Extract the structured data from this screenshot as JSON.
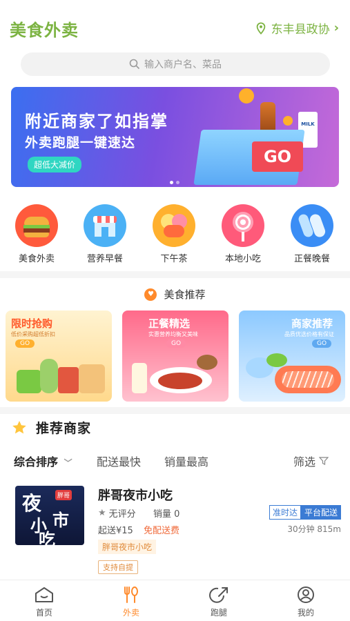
{
  "header": {
    "title": "美食外卖",
    "location": "东丰县政协"
  },
  "search": {
    "placeholder": "输入商户名、菜品"
  },
  "banner": {
    "line1": "附近商家了如指掌",
    "line2": "外卖跑腿一键速达",
    "promo": "超低大减价",
    "go_text": "GO",
    "milk_text": "MILK"
  },
  "categories": [
    {
      "label": "美食外卖",
      "icon": "burger-icon"
    },
    {
      "label": "营养早餐",
      "icon": "shop-icon"
    },
    {
      "label": "下午茶",
      "icon": "macaron-icon"
    },
    {
      "label": "本地小吃",
      "icon": "lollipop-icon"
    },
    {
      "label": "正餐晚餐",
      "icon": "dinner-icon"
    }
  ],
  "recommend": {
    "title": "美食推荐",
    "cards": [
      {
        "title": "限时抢购",
        "subtitle": "低价采购超低折扣",
        "go": "GO"
      },
      {
        "title": "正餐精选",
        "subtitle": "实惠营养均衡又美味",
        "go": "GO"
      },
      {
        "title": "商家推荐",
        "subtitle": "品质优选价格有保证",
        "go": "GO"
      }
    ]
  },
  "merchants": {
    "title": "推荐商家",
    "sort": {
      "options": [
        "综合排序",
        "配送最快",
        "销量最高"
      ],
      "filter": "筛选"
    },
    "items": [
      {
        "name": "胖哥夜市小吃",
        "rating": "无评分",
        "sales": "销量 0",
        "tag_on_time": "准时达",
        "tag_platform": "平台配送",
        "min_order": "起送¥15",
        "delivery_fee": "免配送费",
        "eta": "30分钟 815m",
        "shop_tag": "胖哥夜市小吃",
        "pickup": "支持自提",
        "thumb_text": [
          "夜",
          "市",
          "小",
          "吃"
        ],
        "thumb_badge": "胖哥"
      }
    ]
  },
  "tabbar": {
    "tabs": [
      {
        "label": "首页",
        "icon": "home-icon"
      },
      {
        "label": "外卖",
        "icon": "utensils-icon"
      },
      {
        "label": "跑腿",
        "icon": "errand-icon"
      },
      {
        "label": "我的",
        "icon": "profile-icon"
      }
    ],
    "active_index": 1
  },
  "colors": {
    "brand_green": "#7cb342",
    "accent_orange": "#ff8a2b",
    "tag_blue": "#3b7bd4"
  }
}
